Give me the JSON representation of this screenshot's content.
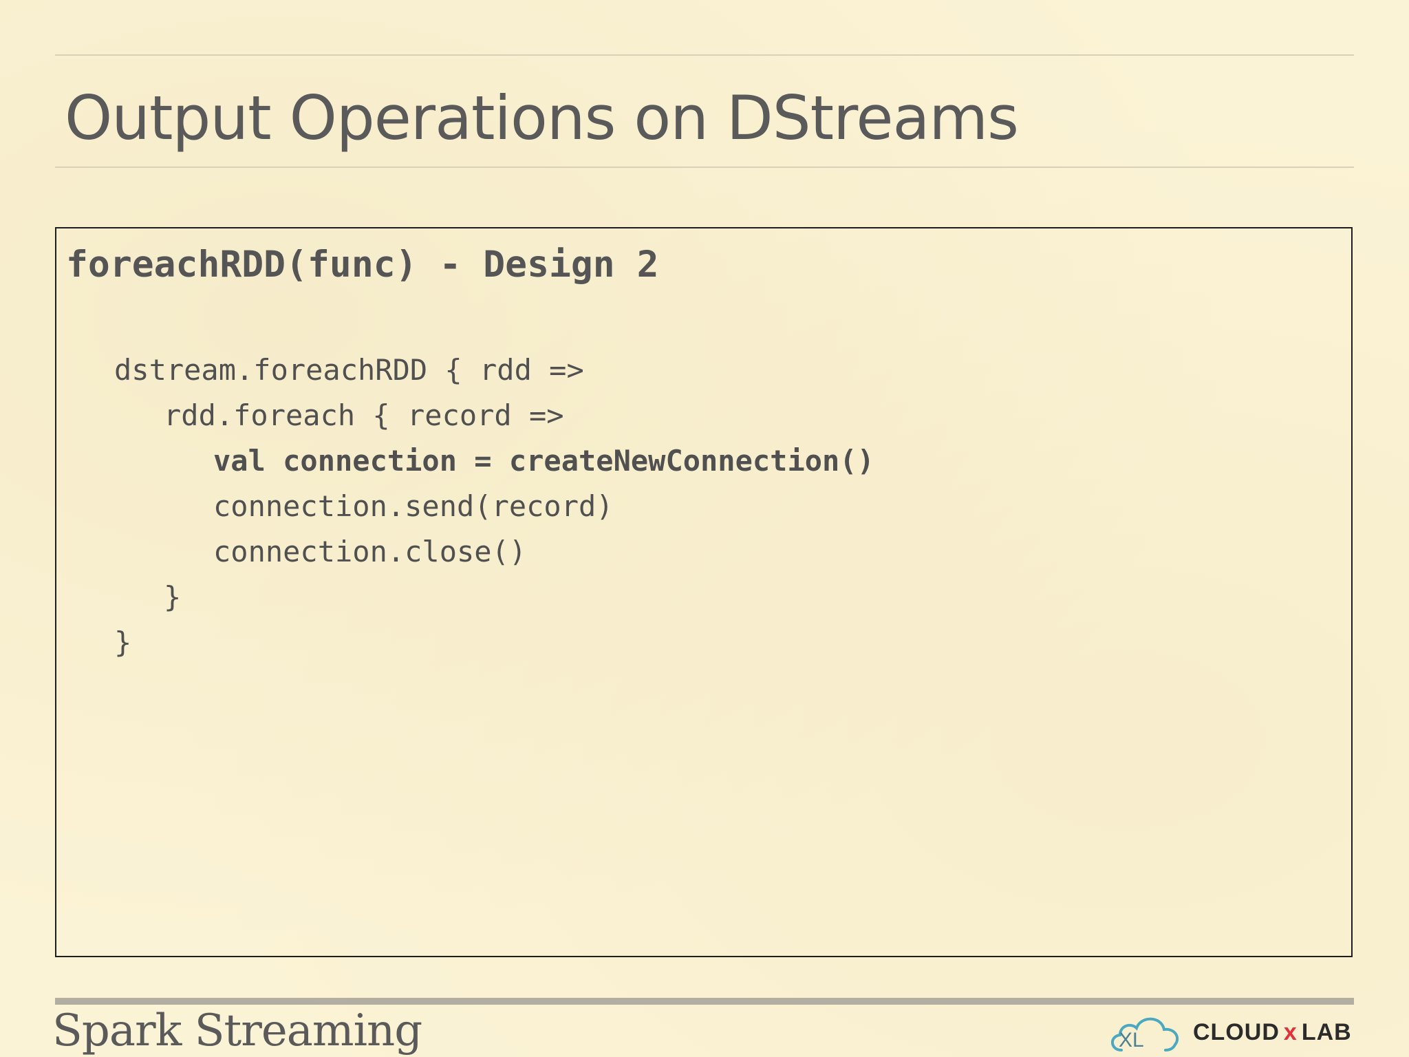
{
  "slide": {
    "title": "Output Operations on DStreams",
    "box_heading": "foreachRDD(func) - Design 2",
    "code_lines": [
      "dstream.foreachRDD { rdd =>",
      "rdd.foreach { record =>",
      "val connection = createNewConnection()",
      "connection.send(record)",
      "connection.close()",
      "}",
      "}"
    ],
    "footer_title": "Spark Streaming"
  },
  "logo": {
    "icon": "cloud-icon",
    "mark": "XL",
    "text_left": "CLOUD",
    "text_x": "x",
    "text_right": "LAB",
    "colors": {
      "cloud": "#4aa8c0",
      "x": "#e0323a",
      "text": "#2b2b2b"
    }
  },
  "colors": {
    "background": "#fbf3d5",
    "title": "#5a5a5a",
    "code": "#505050",
    "box_border": "#1e1e1e"
  }
}
